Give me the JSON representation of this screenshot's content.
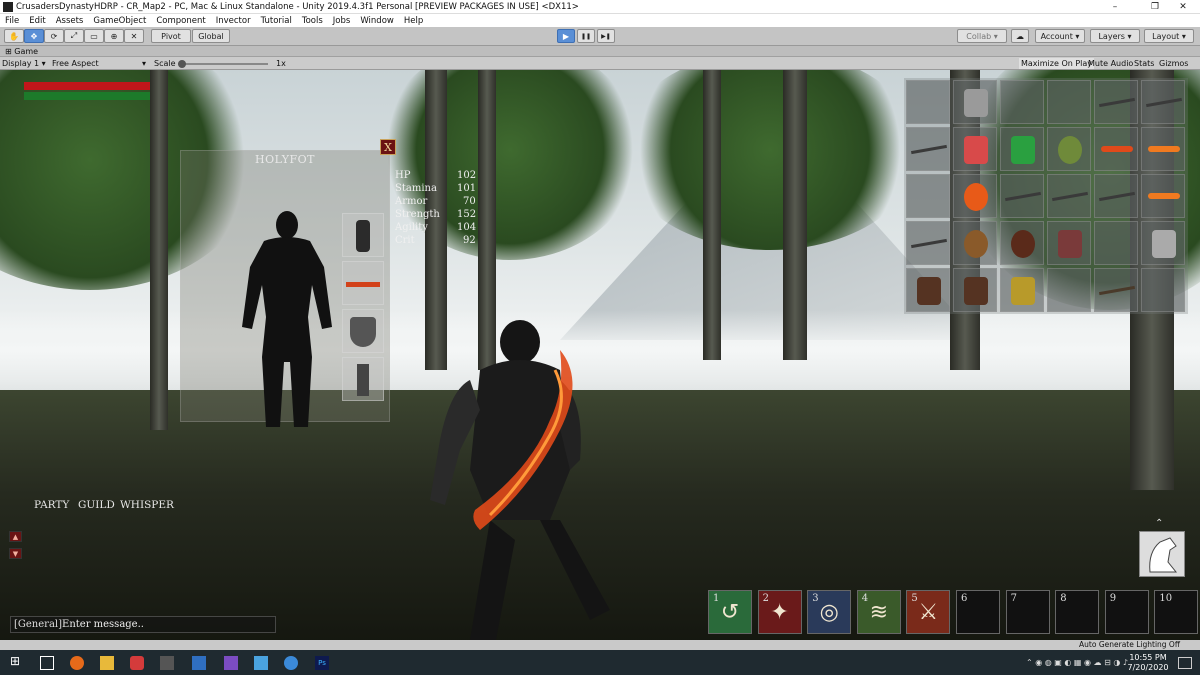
{
  "window": {
    "title": "CrusadersDynastyHDRP - CR_Map2 - PC, Mac & Linux Standalone - Unity 2019.4.3f1 Personal [PREVIEW PACKAGES IN USE] <DX11>",
    "minimize": "–",
    "maximize": "❐",
    "close": "✕"
  },
  "menu": [
    "File",
    "Edit",
    "Assets",
    "GameObject",
    "Component",
    "Invector",
    "Tutorial",
    "Tools",
    "Jobs",
    "Window",
    "Help"
  ],
  "toolbar": {
    "pivot_label": "Pivot",
    "global_label": "Global",
    "play": "▶",
    "pause": "❚❚",
    "step": "▶❚",
    "collab_label": "Collab ▾",
    "account_label": "Account",
    "layers_label": "Layers",
    "layout_label": "Layout"
  },
  "game_tab": {
    "label": "Game",
    "display": "Display 1",
    "aspect": "Free Aspect",
    "scale_label": "Scale",
    "scale_value": "1x",
    "maximize_on_play": "Maximize On Play",
    "mute_audio": "Mute Audio",
    "stats": "Stats",
    "gizmos": "Gizmos"
  },
  "player_bars": {
    "health_color": "#c0161a",
    "mana_color": "#1d7a2a"
  },
  "character_panel": {
    "name": "HOLYFOT",
    "close_label": "X",
    "stats": [
      {
        "label": "HP",
        "value": "102"
      },
      {
        "label": "Stamina",
        "value": "101"
      },
      {
        "label": "Armor",
        "value": "70"
      },
      {
        "label": "Strength",
        "value": "152"
      },
      {
        "label": "Agility",
        "value": "104"
      },
      {
        "label": "Crit",
        "value": "92"
      }
    ],
    "equip_slots": [
      "armor",
      "weapon",
      "shield",
      "boots"
    ]
  },
  "chat": {
    "tabs": [
      "PARTY",
      "GUILD",
      "WHISPER"
    ],
    "channel": "[General]",
    "placeholder": "Enter message.."
  },
  "inventory": {
    "rows": [
      [
        "empty",
        "sword",
        "empty",
        "empty",
        "rifle",
        "rifle"
      ],
      [
        "rifle",
        "red-potion",
        "green-potion",
        "green-orb",
        "flame-sword",
        "fire-bolt"
      ],
      [
        "empty",
        "fire-burst",
        "rifle",
        "rifle",
        "rifle",
        "fire-bolt"
      ],
      [
        "rifle",
        "potato",
        "brown-orb",
        "armor",
        "empty",
        "character"
      ],
      [
        "figure",
        "figure",
        "gold-figure",
        "empty",
        "staff",
        "empty"
      ]
    ]
  },
  "hotbar": [
    {
      "num": "1",
      "icon": "hook-skill-icon"
    },
    {
      "num": "2",
      "icon": "strike-skill-icon"
    },
    {
      "num": "3",
      "icon": "whirl-skill-icon"
    },
    {
      "num": "4",
      "icon": "slash-skill-icon"
    },
    {
      "num": "5",
      "icon": "swords-skill-icon"
    },
    {
      "num": "6",
      "icon": ""
    },
    {
      "num": "7",
      "icon": ""
    },
    {
      "num": "8",
      "icon": ""
    },
    {
      "num": "9",
      "icon": ""
    },
    {
      "num": "10",
      "icon": ""
    }
  ],
  "status_bar": {
    "text": "Auto Generate Lighting Off"
  },
  "taskbar": {
    "time": "10:55 PM",
    "date": "7/20/2020"
  }
}
